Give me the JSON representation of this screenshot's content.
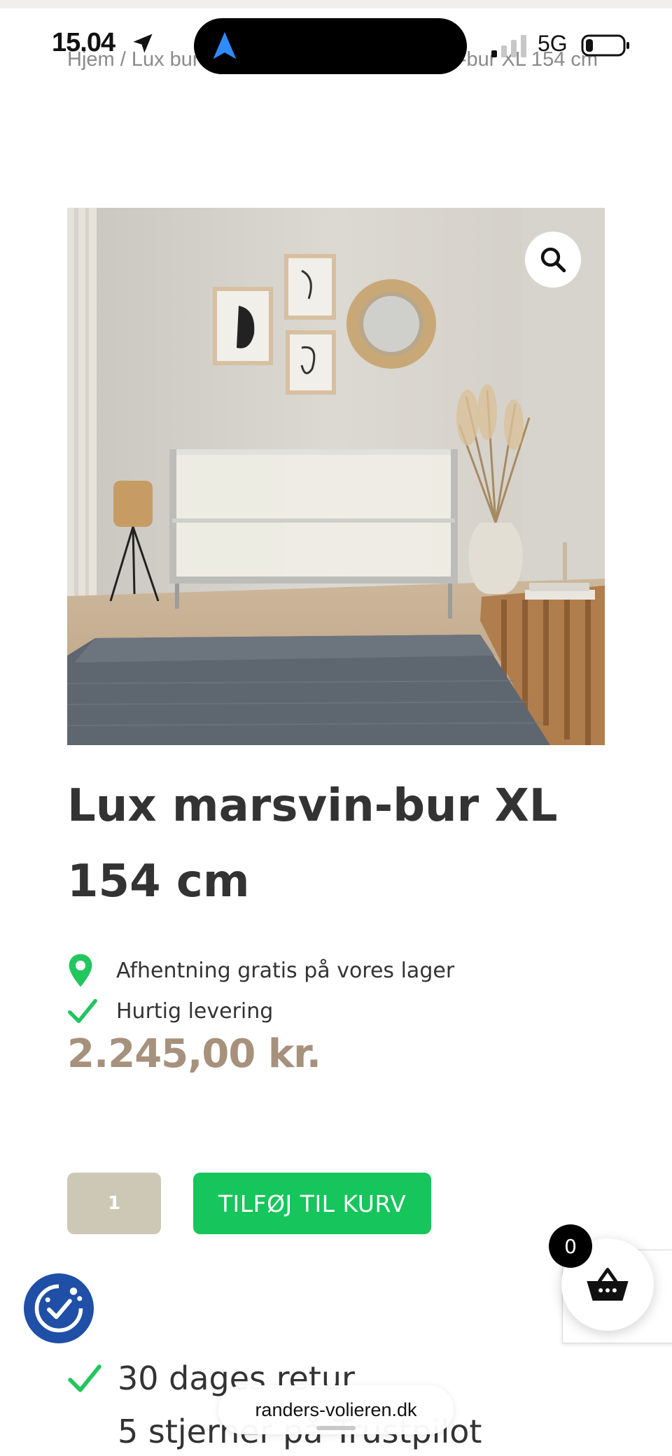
{
  "status_bar": {
    "time": "15.04",
    "network": "5G"
  },
  "breadcrumb": {
    "text": "Hjem / Lux bur / Marsvin bure / Lux marsvin-bur XL 154 cm"
  },
  "product": {
    "title": "Lux marsvin-bur XL 154 cm",
    "features": [
      {
        "icon": "map-pin-icon",
        "text": "Afhentning gratis på vores lager"
      },
      {
        "icon": "checkmark-icon",
        "text": "Hurtig levering"
      }
    ],
    "price": "2.245,00  kr."
  },
  "purchase": {
    "quantity": "1",
    "add_to_cart_label": "TILFØJ TIL KURV"
  },
  "cart": {
    "count": "0"
  },
  "benefits": [
    {
      "icon": "checkmark-icon",
      "text": "30 dages retur"
    },
    {
      "text": "5 stjerner på Trustpilot"
    }
  ],
  "browser": {
    "url": "randers-volieren.dk"
  },
  "colors": {
    "accent_green": "#16c55b",
    "price_color": "#a6917d",
    "quantity_bg": "#cdc8b6",
    "cookie_blue": "#1f4fa6"
  }
}
